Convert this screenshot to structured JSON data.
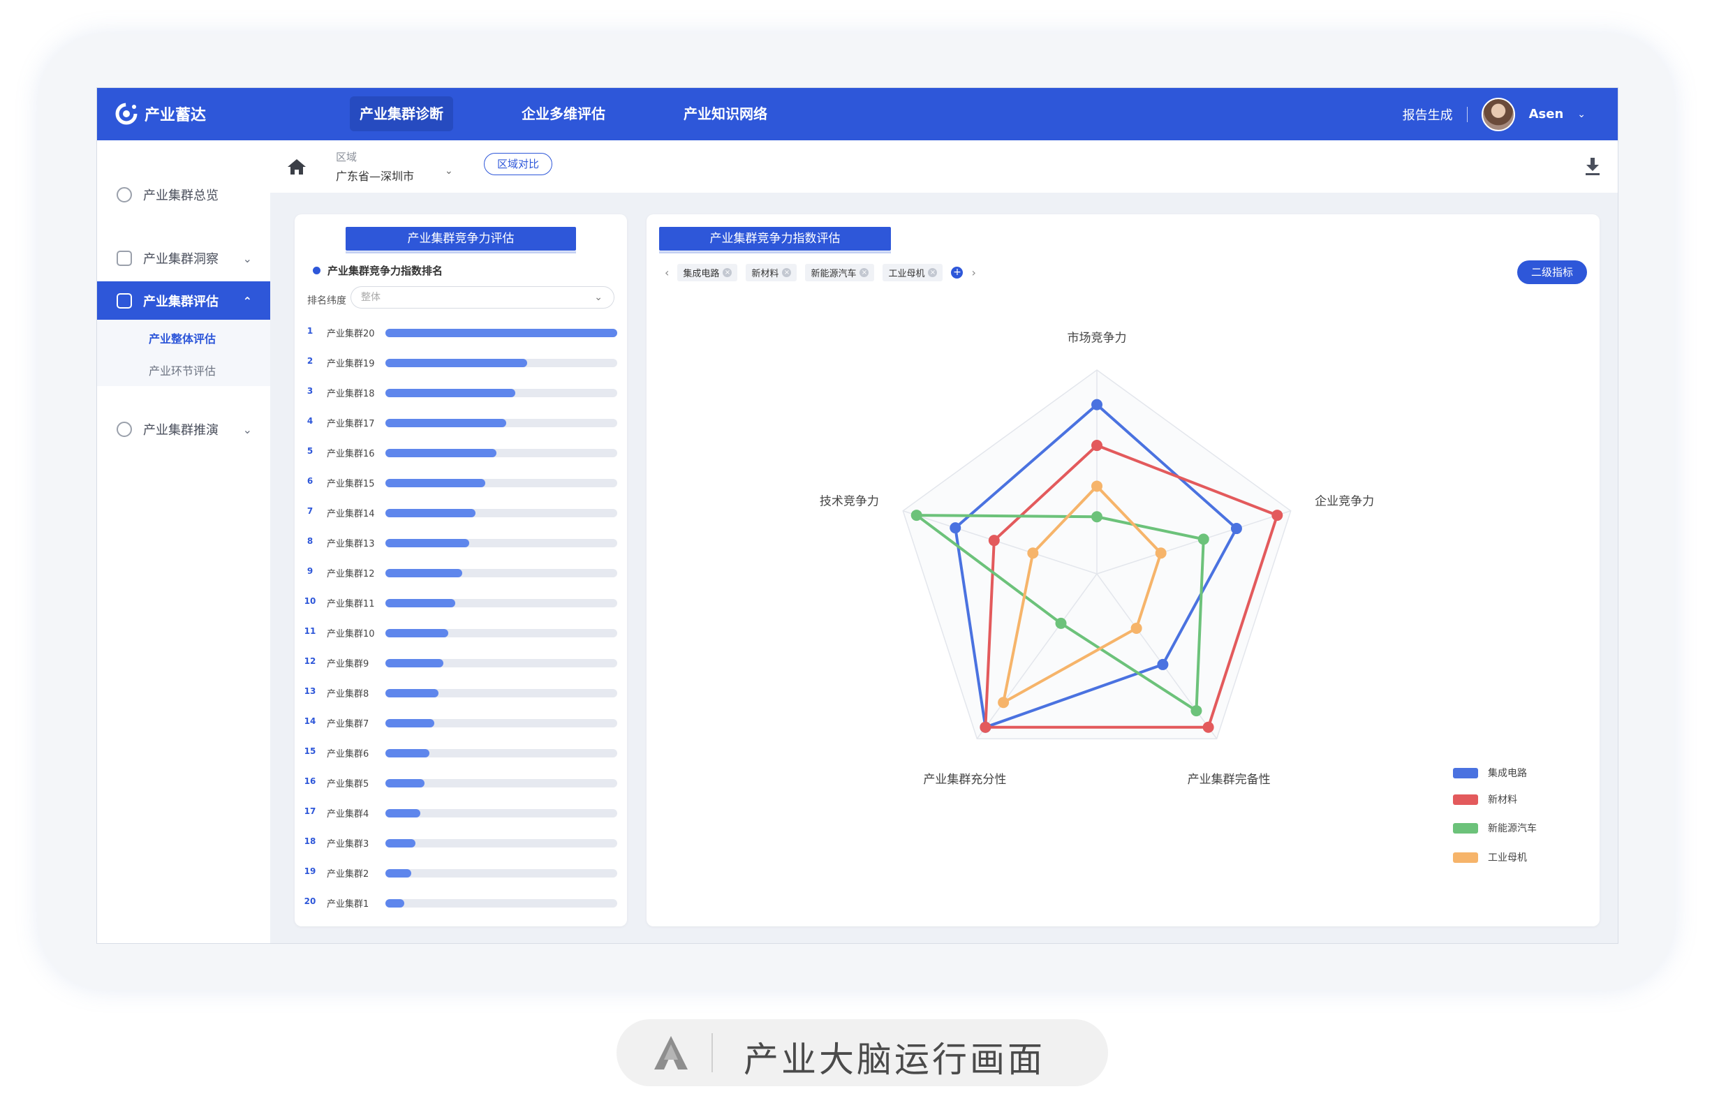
{
  "app": {
    "logo_text": "产业蓄达",
    "nav_tabs": [
      "产业集群诊断",
      "企业多维评估",
      "产业知识网络"
    ],
    "report_label": "报告生成",
    "user_name": "Asen"
  },
  "sidebar": {
    "items": [
      {
        "label": "产业集群总览"
      },
      {
        "label": "产业集群洞察"
      },
      {
        "label": "产业集群评估"
      },
      {
        "label": "产业集群推演"
      }
    ],
    "sub_items": [
      "产业整体评估",
      "产业环节评估"
    ]
  },
  "breadcrumb": {
    "region_label": "区域",
    "region_value": "广东省—深圳市",
    "compare_button": "区域对比"
  },
  "left_panel": {
    "title": "产业集群竞争力评估",
    "subtitle": "产业集群竞争力指数排名",
    "dimension_label": "排名纬度",
    "dimension_placeholder": "整体",
    "rankings": [
      {
        "rank": "1",
        "name": "产业集群20",
        "value": 1.0
      },
      {
        "rank": "2",
        "name": "产业集群19",
        "value": 0.61
      },
      {
        "rank": "3",
        "name": "产业集群18",
        "value": 0.56
      },
      {
        "rank": "4",
        "name": "产业集群17",
        "value": 0.52
      },
      {
        "rank": "5",
        "name": "产业集群16",
        "value": 0.48
      },
      {
        "rank": "6",
        "name": "产业集群15",
        "value": 0.43
      },
      {
        "rank": "7",
        "name": "产业集群14",
        "value": 0.39
      },
      {
        "rank": "8",
        "name": "产业集群13",
        "value": 0.36
      },
      {
        "rank": "9",
        "name": "产业集群12",
        "value": 0.33
      },
      {
        "rank": "10",
        "name": "产业集群11",
        "value": 0.3
      },
      {
        "rank": "11",
        "name": "产业集群10",
        "value": 0.27
      },
      {
        "rank": "12",
        "name": "产业集群9",
        "value": 0.25
      },
      {
        "rank": "13",
        "name": "产业集群8",
        "value": 0.23
      },
      {
        "rank": "14",
        "name": "产业集群7",
        "value": 0.21
      },
      {
        "rank": "15",
        "name": "产业集群6",
        "value": 0.19
      },
      {
        "rank": "16",
        "name": "产业集群5",
        "value": 0.17
      },
      {
        "rank": "17",
        "name": "产业集群4",
        "value": 0.15
      },
      {
        "rank": "18",
        "name": "产业集群3",
        "value": 0.13
      },
      {
        "rank": "19",
        "name": "产业集群2",
        "value": 0.11
      },
      {
        "rank": "20",
        "name": "产业集群1",
        "value": 0.08
      }
    ]
  },
  "right_panel": {
    "title": "产业集群竞争力指数评估",
    "tags": [
      "集成电路",
      "新材料",
      "新能源汽车",
      "工业母机"
    ],
    "secondary_button": "二级指标"
  },
  "chart_data": {
    "type": "radar",
    "axes": [
      "市场竞争力",
      "企业竞争力",
      "产业集群完备性",
      "产业集群充分性",
      "技术竞争力"
    ],
    "max": 1.0,
    "rings": 5,
    "series": [
      {
        "name": "集成电路",
        "color": "#4a72e0",
        "values": [
          0.83,
          0.72,
          0.55,
          0.93,
          0.73
        ]
      },
      {
        "name": "新材料",
        "color": "#e35a5c",
        "values": [
          0.63,
          0.93,
          0.93,
          0.93,
          0.53
        ]
      },
      {
        "name": "新能源汽车",
        "color": "#6cc27a",
        "values": [
          0.28,
          0.55,
          0.83,
          0.3,
          0.93
        ]
      },
      {
        "name": "工业母机",
        "color": "#f6b46a",
        "values": [
          0.43,
          0.33,
          0.33,
          0.78,
          0.33
        ]
      }
    ]
  },
  "caption": {
    "text": "产业大脑运行画面"
  }
}
